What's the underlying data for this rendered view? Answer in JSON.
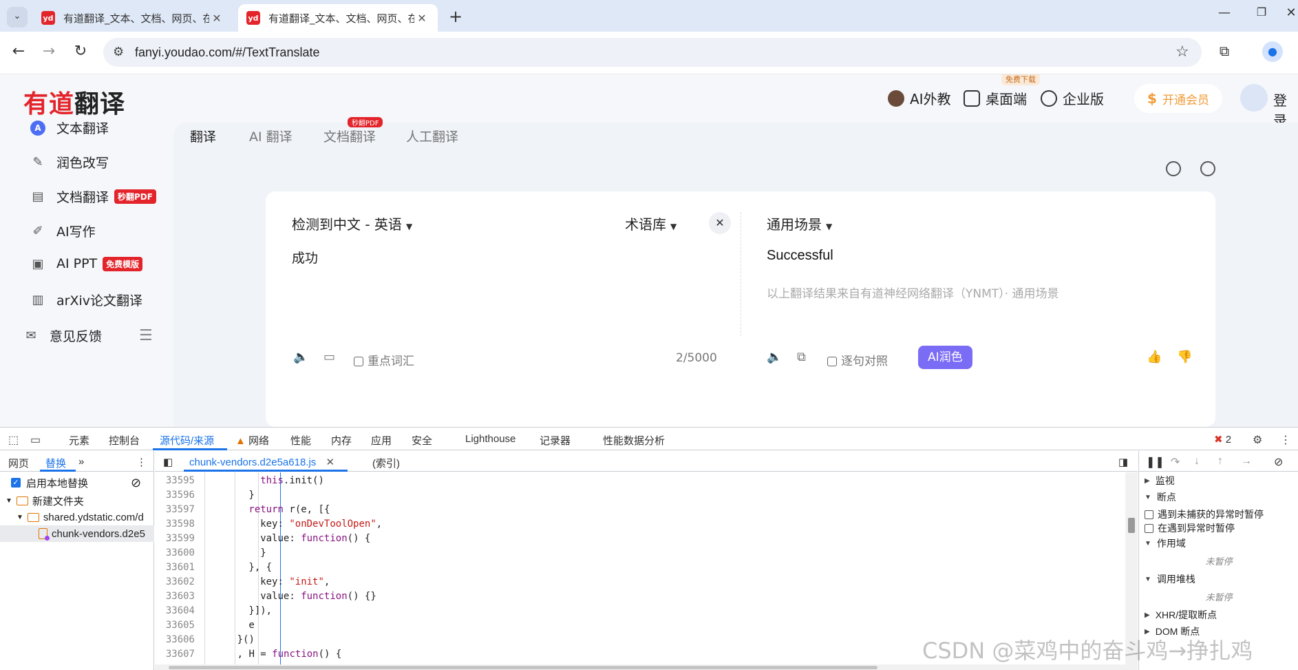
{
  "browser": {
    "tabs": [
      {
        "title": "有道翻译_文本、文档、网页、在",
        "favicon": "yd",
        "active": false
      },
      {
        "title": "有道翻译_文本、文档、网页、在",
        "favicon": "yd",
        "active": true
      }
    ],
    "url": "fanyi.youdao.com/#/TextTranslate"
  },
  "youdao": {
    "logo_red": "有道",
    "logo_black": "翻译",
    "header": {
      "ai_tutor": "AI外教",
      "desktop": "桌面端",
      "desktop_badge": "免费下载",
      "enterprise": "企业版",
      "vip": "开通会员",
      "login": "登录"
    },
    "sidebar": [
      {
        "label": "文本翻译",
        "icon": "text-translate-icon",
        "badge": ""
      },
      {
        "label": "润色改写",
        "icon": "polish-icon",
        "badge": ""
      },
      {
        "label": "文档翻译",
        "icon": "document-icon",
        "badge": "秒翻PDF"
      },
      {
        "label": "AI写作",
        "icon": "ai-write-icon",
        "badge": ""
      },
      {
        "label": "AI PPT",
        "icon": "ppt-icon",
        "badge": "免费模版"
      },
      {
        "label": "arXiv论文翻译",
        "icon": "arxiv-icon",
        "badge": ""
      },
      {
        "label": "意见反馈",
        "icon": "feedback-icon",
        "badge": ""
      }
    ],
    "top_tabs": [
      "翻译",
      "AI 翻译",
      "文档翻译",
      "人工翻译"
    ],
    "top_tab_badge": "秒翻PDF",
    "source": {
      "lang_label": "检测到中文 - 英语",
      "glossary": "术语库",
      "text": "成功",
      "key_vocab": "重点词汇",
      "count": "2/5000"
    },
    "target": {
      "scene": "通用场景",
      "text": "Successful",
      "note": "以上翻译结果来自有道神经网络翻译（YNMT）· 通用场景",
      "sentence_compare": "逐句对照",
      "ai_polish": "AI润色"
    }
  },
  "devtools": {
    "tabs": [
      "元素",
      "控制台",
      "源代码/来源",
      "网络",
      "性能",
      "内存",
      "应用",
      "安全",
      "Lighthouse",
      "记录器",
      "性能数据分析"
    ],
    "active_tab": "源代码/来源",
    "error_count": "2",
    "left_tabs": [
      "网页",
      "替换"
    ],
    "enable_overrides": "启用本地替换",
    "tree": [
      "新建文件夹",
      "shared.ydstatic.com/d",
      "chunk-vendors.d2e5"
    ],
    "editor_tabs": [
      "chunk-vendors.d2e5a618.js",
      "(索引)"
    ],
    "code_lines": [
      {
        "n": "33595",
        "indent": 8,
        "parts": [
          {
            "t": "this",
            "c": "kw"
          },
          {
            "t": ".init()",
            "c": ""
          }
        ]
      },
      {
        "n": "33596",
        "indent": 6,
        "parts": [
          {
            "t": "}",
            "c": ""
          }
        ]
      },
      {
        "n": "33597",
        "indent": 6,
        "parts": [
          {
            "t": "return",
            "c": "kw"
          },
          {
            "t": " r(e, [{",
            "c": ""
          }
        ]
      },
      {
        "n": "33598",
        "indent": 8,
        "parts": [
          {
            "t": "key: ",
            "c": ""
          },
          {
            "t": "\"onDevToolOpen\"",
            "c": "str"
          },
          {
            "t": ",",
            "c": ""
          }
        ]
      },
      {
        "n": "33599",
        "indent": 8,
        "parts": [
          {
            "t": "value: ",
            "c": ""
          },
          {
            "t": "function",
            "c": "kw"
          },
          {
            "t": "() {",
            "c": ""
          }
        ]
      },
      {
        "n": "33600",
        "indent": 8,
        "parts": [
          {
            "t": "}",
            "c": ""
          }
        ]
      },
      {
        "n": "33601",
        "indent": 6,
        "parts": [
          {
            "t": "}, {",
            "c": ""
          }
        ]
      },
      {
        "n": "33602",
        "indent": 8,
        "parts": [
          {
            "t": "key: ",
            "c": ""
          },
          {
            "t": "\"init\"",
            "c": "str"
          },
          {
            "t": ",",
            "c": ""
          }
        ]
      },
      {
        "n": "33603",
        "indent": 8,
        "parts": [
          {
            "t": "value: ",
            "c": ""
          },
          {
            "t": "function",
            "c": "kw"
          },
          {
            "t": "() {}",
            "c": ""
          }
        ]
      },
      {
        "n": "33604",
        "indent": 6,
        "parts": [
          {
            "t": "}]),",
            "c": ""
          }
        ]
      },
      {
        "n": "33605",
        "indent": 6,
        "parts": [
          {
            "t": "e",
            "c": ""
          }
        ]
      },
      {
        "n": "33606",
        "indent": 4,
        "parts": [
          {
            "t": "}()",
            "c": ""
          }
        ]
      },
      {
        "n": "33607",
        "indent": 4,
        "parts": [
          {
            "t": ", H = ",
            "c": ""
          },
          {
            "t": "function",
            "c": "kw"
          },
          {
            "t": "() {",
            "c": ""
          }
        ]
      }
    ],
    "right_panes": {
      "watch": "监视",
      "breakpoints": "断点",
      "pause_uncaught": "遇到未捕获的异常时暂停",
      "pause_caught": "在遇到异常时暂停",
      "scope": "作用域",
      "not_paused_1": "未暂停",
      "call_stack": "调用堆栈",
      "not_paused_2": "未暂停",
      "xhr": "XHR/提取断点",
      "dom": "DOM 断点"
    }
  },
  "watermark": "CSDN @菜鸡中的奋斗鸡→挣扎鸡",
  "colors": {
    "youdao_red": "#e3242b",
    "ai_polish_purple": "#7b6cf6",
    "devtools_blue": "#1a73e8"
  }
}
